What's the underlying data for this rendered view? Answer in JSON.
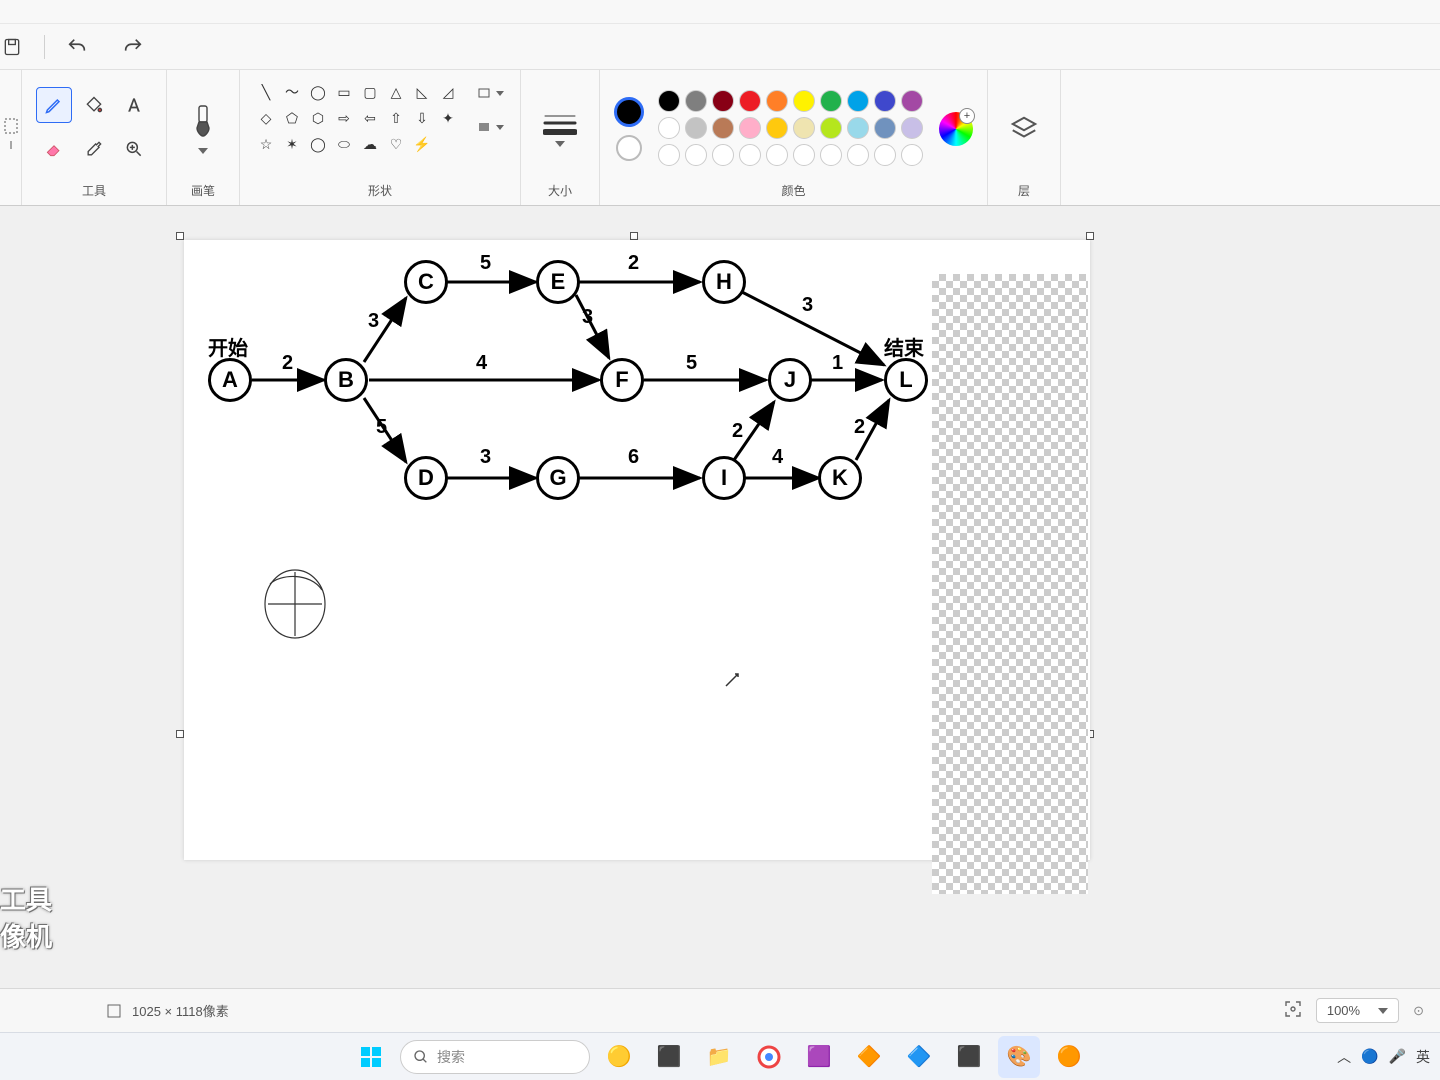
{
  "chart_data": {
    "type": "network",
    "title": "",
    "nodes": [
      "A",
      "B",
      "C",
      "D",
      "E",
      "F",
      "G",
      "H",
      "I",
      "J",
      "K",
      "L"
    ],
    "labels": {
      "start": "开始",
      "end": "结束"
    },
    "edges": [
      {
        "from": "A",
        "to": "B",
        "weight": 2
      },
      {
        "from": "B",
        "to": "C",
        "weight": 3
      },
      {
        "from": "B",
        "to": "F",
        "weight": 4
      },
      {
        "from": "B",
        "to": "D",
        "weight": 5
      },
      {
        "from": "C",
        "to": "E",
        "weight": 5
      },
      {
        "from": "E",
        "to": "F",
        "weight": 3
      },
      {
        "from": "E",
        "to": "H",
        "weight": 2
      },
      {
        "from": "D",
        "to": "G",
        "weight": 3
      },
      {
        "from": "G",
        "to": "I",
        "weight": 6
      },
      {
        "from": "F",
        "to": "J",
        "weight": 5
      },
      {
        "from": "I",
        "to": "J",
        "weight": 2
      },
      {
        "from": "I",
        "to": "K",
        "weight": 4
      },
      {
        "from": "H",
        "to": "L",
        "weight": 3
      },
      {
        "from": "J",
        "to": "L",
        "weight": 1
      },
      {
        "from": "K",
        "to": "L",
        "weight": 2
      }
    ]
  },
  "ribbon": {
    "group_tools": "工具",
    "group_brushes": "画笔",
    "group_shapes": "形状",
    "group_size": "大小",
    "group_colors": "颜色",
    "group_layers": "层"
  },
  "colors_row1": [
    "#000000",
    "#7f7f7f",
    "#880015",
    "#ed1c24",
    "#ff7f27",
    "#fff200",
    "#22b14c",
    "#00a2e8",
    "#3f48cc",
    "#a349a4"
  ],
  "colors_row2": [
    "#ffffff",
    "#c3c3c3",
    "#b97a57",
    "#ffaec9",
    "#ffc90e",
    "#efe4b0",
    "#b5e61d",
    "#99d9ea",
    "#7092be",
    "#c8bfe7"
  ],
  "colors_row3": [
    "#fff",
    "#fff",
    "#fff",
    "#fff",
    "#fff",
    "#fff",
    "#fff",
    "#fff",
    "#fff",
    "#fff"
  ],
  "status": {
    "dimensions": "1025 × 1118像素",
    "zoom": "100%"
  },
  "taskbar": {
    "search_placeholder": "搜索",
    "ime": "英"
  },
  "watermark": {
    "l1": "工具",
    "l2": "像机"
  }
}
